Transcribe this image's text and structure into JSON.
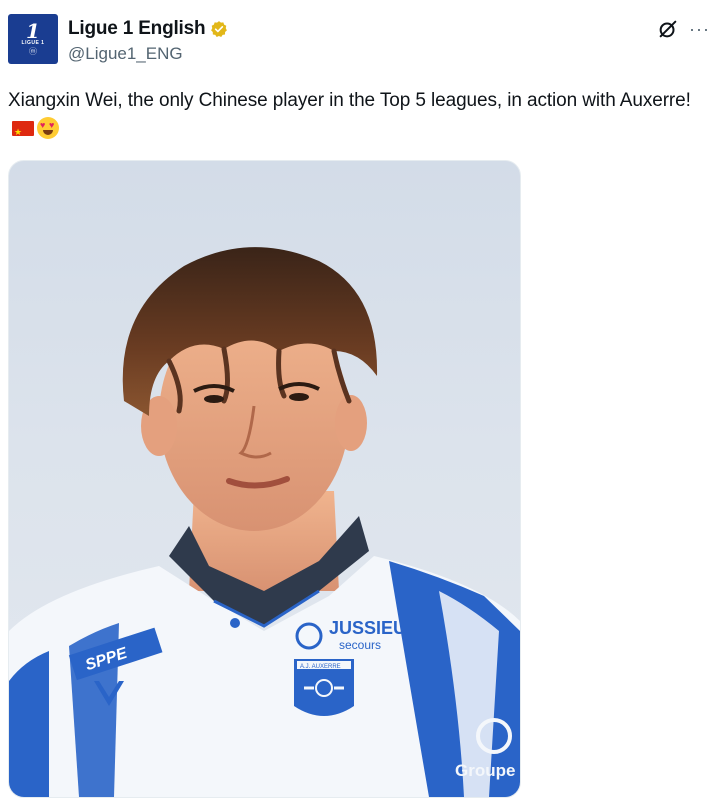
{
  "account": {
    "display_name": "Ligue 1 English",
    "handle": "@Ligue1_ENG",
    "avatar_num": "1",
    "avatar_small": "LIGUE 1",
    "avatar_mark": "ⓜ",
    "verified_color": "#e2b719"
  },
  "tweet": {
    "text": "Xiangxin Wei, the only Chinese player in the Top 5 leagues, in action with Auxerre!",
    "emojis": [
      "china-flag",
      "heart-eyes-face"
    ]
  },
  "media": {
    "alt": "Xiangxin Wei in Auxerre kit",
    "kit_texts": {
      "sponsor_main": "JUSSIEU",
      "sponsor_sub": "secours",
      "sleeve": "SPPE",
      "crest": "A.J. AUXERRE",
      "corner": "Groupe"
    },
    "colors": {
      "kit_blue": "#2a64c8",
      "kit_white": "#f4f7fb",
      "collar": "#2f3a4c"
    }
  },
  "actions": {
    "more_label": "···"
  }
}
